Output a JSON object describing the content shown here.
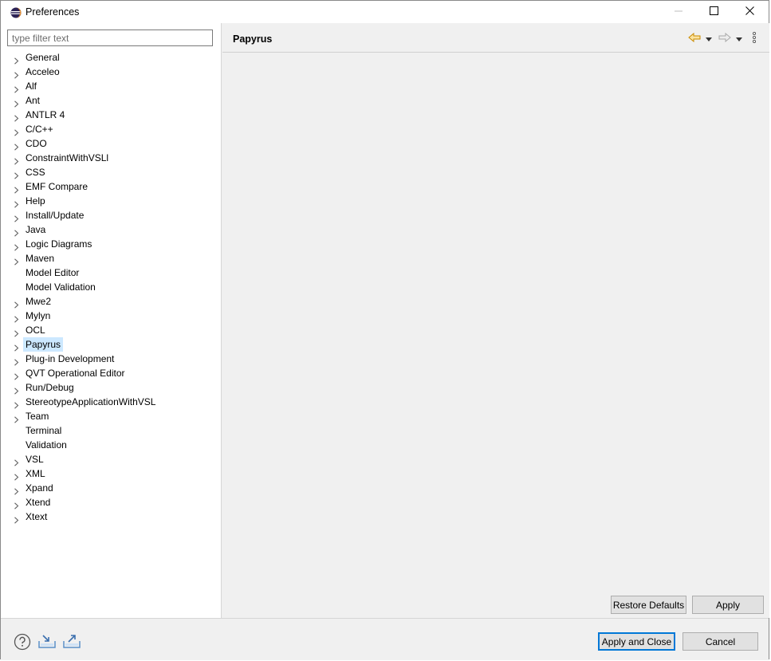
{
  "window": {
    "title": "Preferences",
    "app_icon": "eclipse-icon",
    "controls": [
      "minimize-icon",
      "maximize-icon",
      "close-icon"
    ]
  },
  "filter": {
    "placeholder": "type filter text",
    "value": ""
  },
  "tree": {
    "items": [
      {
        "label": "General",
        "expandable": true
      },
      {
        "label": "Acceleo",
        "expandable": true
      },
      {
        "label": "Alf",
        "expandable": true
      },
      {
        "label": "Ant",
        "expandable": true
      },
      {
        "label": "ANTLR 4",
        "expandable": true
      },
      {
        "label": "C/C++",
        "expandable": true
      },
      {
        "label": "CDO",
        "expandable": true
      },
      {
        "label": "ConstraintWithVSLl",
        "expandable": true
      },
      {
        "label": "CSS",
        "expandable": true
      },
      {
        "label": "EMF Compare",
        "expandable": true
      },
      {
        "label": "Help",
        "expandable": true
      },
      {
        "label": "Install/Update",
        "expandable": true
      },
      {
        "label": "Java",
        "expandable": true
      },
      {
        "label": "Logic Diagrams",
        "expandable": true
      },
      {
        "label": "Maven",
        "expandable": true
      },
      {
        "label": "Model Editor",
        "expandable": false
      },
      {
        "label": "Model Validation",
        "expandable": false
      },
      {
        "label": "Mwe2",
        "expandable": true
      },
      {
        "label": "Mylyn",
        "expandable": true
      },
      {
        "label": "OCL",
        "expandable": true
      },
      {
        "label": "Papyrus",
        "expandable": true,
        "selected": true
      },
      {
        "label": "Plug-in Development",
        "expandable": true
      },
      {
        "label": "QVT Operational Editor",
        "expandable": true
      },
      {
        "label": "Run/Debug",
        "expandable": true
      },
      {
        "label": "StereotypeApplicationWithVSL",
        "expandable": true
      },
      {
        "label": "Team",
        "expandable": true
      },
      {
        "label": "Terminal",
        "expandable": false
      },
      {
        "label": "Validation",
        "expandable": false
      },
      {
        "label": "VSL",
        "expandable": true
      },
      {
        "label": "XML",
        "expandable": true
      },
      {
        "label": "Xpand",
        "expandable": true
      },
      {
        "label": "Xtend",
        "expandable": true
      },
      {
        "label": "Xtext",
        "expandable": true
      }
    ]
  },
  "page": {
    "title": "Papyrus",
    "nav_icons": [
      "back-arrow-icon",
      "dropdown-icon",
      "forward-arrow-icon",
      "dropdown-icon",
      "view-menu-icon"
    ],
    "restore_defaults_label": "Restore Defaults",
    "apply_label": "Apply"
  },
  "footer": {
    "icons": [
      "help-icon",
      "import-icon",
      "export-icon"
    ],
    "apply_close_label": "Apply and Close",
    "cancel_label": "Cancel"
  },
  "colors": {
    "selection": "#cce8ff",
    "default_button_border": "#0078d7",
    "back_arrow": "#e8a317"
  }
}
